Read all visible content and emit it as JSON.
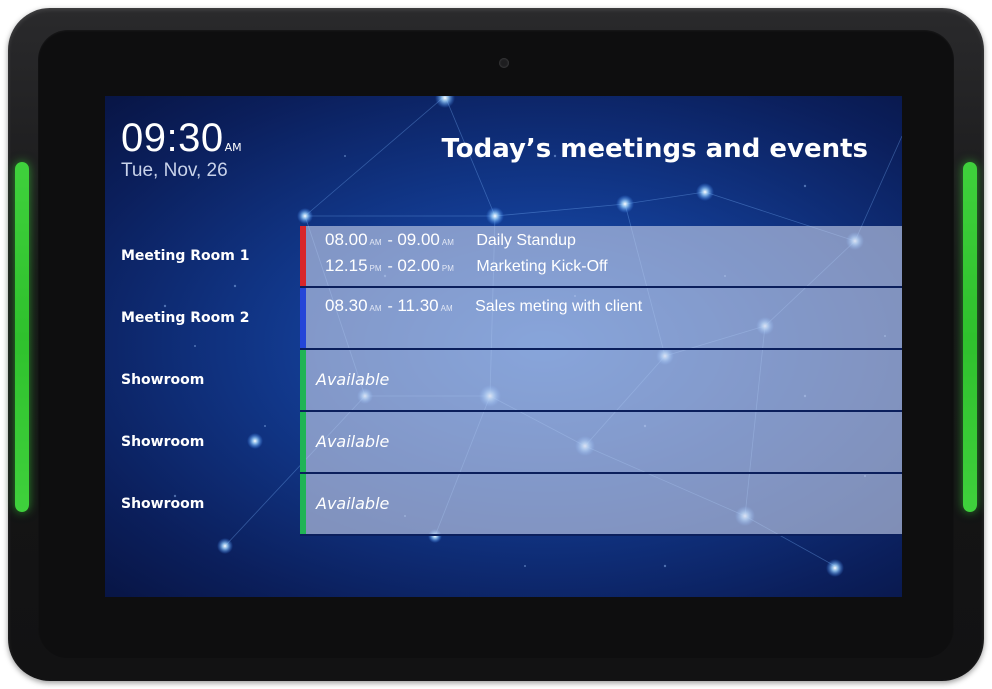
{
  "clock": {
    "time": "09:30",
    "ampm": "AM",
    "date": "Tue, Nov, 26"
  },
  "header": {
    "title": "Today’s meetings and events"
  },
  "colors": {
    "led": "#3fd13c",
    "busy_red": "#d8262a",
    "busy_blue": "#2446d8",
    "free_green": "#20b455"
  },
  "rooms": [
    {
      "name": "Meeting Room 1",
      "status_color": "#d8262a",
      "events": [
        {
          "start": "08.00",
          "start_ap": "AM",
          "end": "09.00",
          "end_ap": "AM",
          "title": "Daily Standup"
        },
        {
          "start": "12.15",
          "start_ap": "PM",
          "end": "02.00",
          "end_ap": "PM",
          "title": "Marketing Kick-Off"
        }
      ]
    },
    {
      "name": "Meeting Room 2",
      "status_color": "#2446d8",
      "events": [
        {
          "start": "08.30",
          "start_ap": "AM",
          "end": "11.30",
          "end_ap": "AM",
          "title": "Sales meting with client"
        }
      ]
    },
    {
      "name": "Showroom",
      "status_color": "#20b455",
      "available": "Available"
    },
    {
      "name": "Showroom",
      "status_color": "#20b455",
      "available": "Available"
    },
    {
      "name": "Showroom",
      "status_color": "#20b455",
      "available": "Available"
    }
  ]
}
